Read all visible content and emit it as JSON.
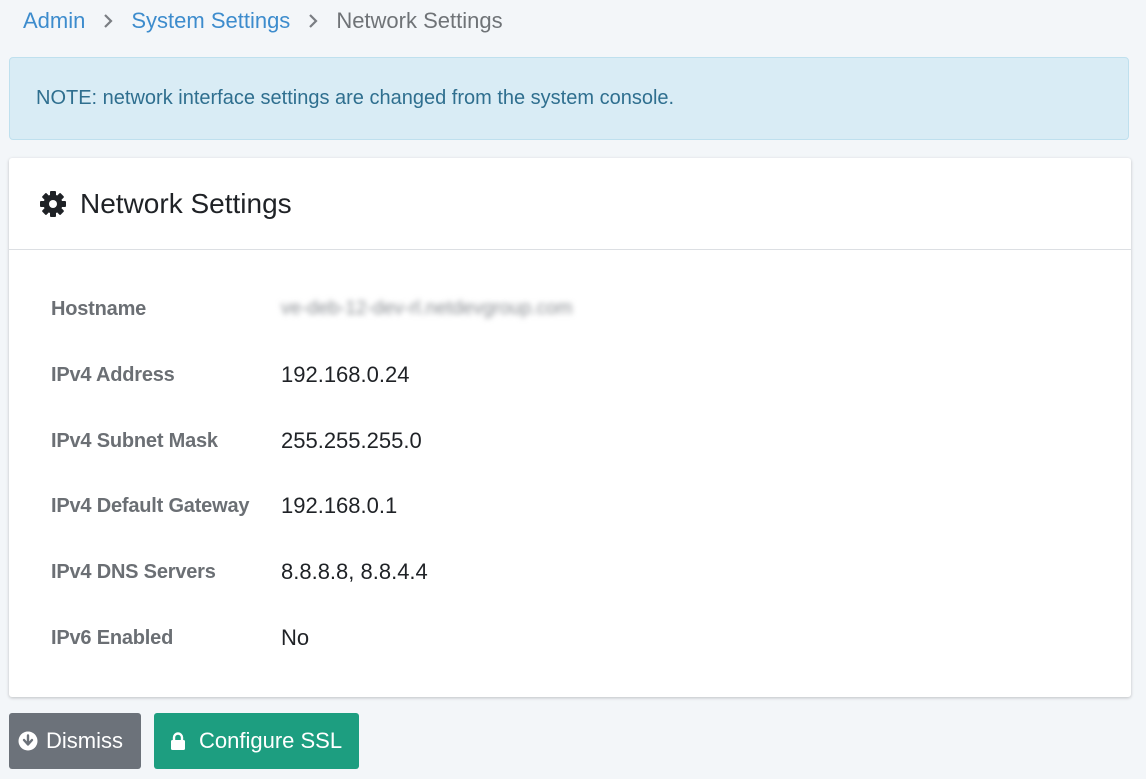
{
  "breadcrumb": {
    "items": [
      {
        "label": "Admin"
      },
      {
        "label": "System Settings"
      },
      {
        "label": "Network Settings"
      }
    ]
  },
  "note": {
    "text": "NOTE: network interface settings are changed from the system console."
  },
  "card": {
    "title": "Network Settings",
    "rows": [
      {
        "label": "Hostname",
        "value": "ve-deb-12-dev-rl.netdevgroup.com"
      },
      {
        "label": "IPv4 Address",
        "value": "192.168.0.24"
      },
      {
        "label": "IPv4 Subnet Mask",
        "value": "255.255.255.0"
      },
      {
        "label": "IPv4 Default Gateway",
        "value": "192.168.0.1"
      },
      {
        "label": "IPv4 DNS Servers",
        "value": "8.8.8.8, 8.8.4.4"
      },
      {
        "label": "IPv6 Enabled",
        "value": "No"
      }
    ]
  },
  "actions": {
    "dismiss_label": "Dismiss",
    "ssl_label": "Configure SSL"
  },
  "icons": {
    "header": "gear-icon",
    "dismiss": "arrow-circle-down-icon",
    "ssl": "lock-icon",
    "separator": "chevron-right-icon"
  },
  "colors": {
    "link": "#3d8ccd",
    "note_bg": "#d9ecf5",
    "note_text": "#2f6f8f",
    "dismiss_bg": "#6c727a",
    "ssl_bg": "#1d9e80"
  }
}
